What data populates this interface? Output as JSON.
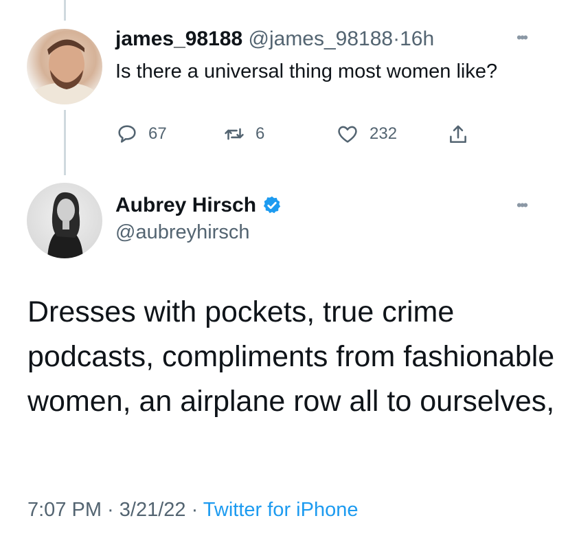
{
  "reply_tweet": {
    "display_name": "james_98188",
    "handle": "@james_98188",
    "separator": "·",
    "time_ago": "16h",
    "text": "Is there a universal thing most women like?",
    "more_icon": "more-icon",
    "actions": {
      "replies": "67",
      "retweets": "6",
      "likes": "232"
    }
  },
  "main_tweet": {
    "display_name": "Aubrey Hirsch",
    "handle": "@aubreyhirsch",
    "verified_icon": "verified-badge-icon",
    "text": "Dresses with pockets, true crime podcasts, compliments from fashionable women, an airplane row all to ourselves,",
    "time": "7:07 PM",
    "separator1": " · ",
    "date": "3/21/22",
    "separator2": " · ",
    "source": "Twitter for iPhone"
  },
  "colors": {
    "accent": "#1d9bf0",
    "muted": "#536471",
    "thread_line": "#cfd9de",
    "text": "#0f1419"
  }
}
